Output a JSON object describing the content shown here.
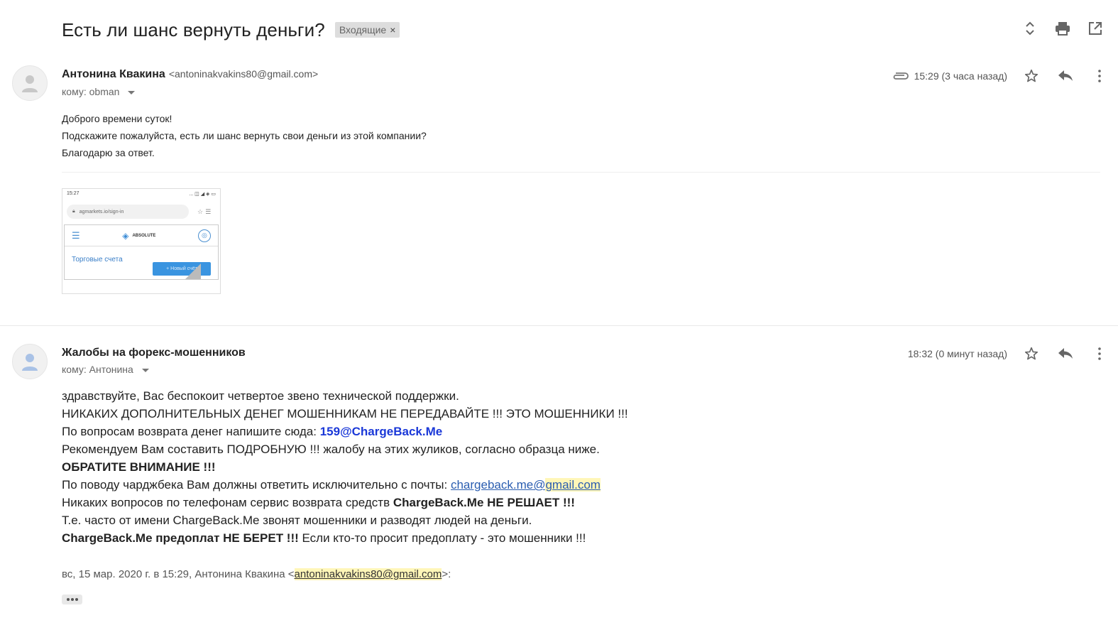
{
  "thread": {
    "subject": "Есть ли шанс вернуть деньги?",
    "label": "Входящие",
    "label_remove": "×"
  },
  "toolbar_icons": [
    "expand-all-icon",
    "print-icon",
    "open-new-window-icon"
  ],
  "message1": {
    "sender_name": "Антонина Квакина",
    "sender_email": "<antoninakvakins80@gmail.com>",
    "to_label": "кому: obman",
    "time": "15:29 (3 часа назад)",
    "has_attachment": true,
    "body": [
      "Доброго времени суток!",
      "Подскажите пожалуйста, есть ли шанс вернуть свои деньги из этой компании?",
      "Благодарю за ответ."
    ],
    "attachment": {
      "status_time": "15:27",
      "status_icons": "... ◫ ◢ ◈ ▭",
      "url": "agmarkets.io/sign-in",
      "logo_text": "ABSOLUTE",
      "title": "Торговые счета",
      "button": "+ Новый счёт"
    }
  },
  "message2": {
    "sender_name": "Жалобы на форекс-мошенников",
    "to_label": "кому: Антонина",
    "time": "18:32 (0 минут назад)",
    "lines": {
      "l1": "здравствуйте, Вас беспокоит четвертое звено технической поддержки.",
      "l2": "НИКАКИХ ДОПОЛНИТЕЛЬНЫХ ДЕНЕГ МОШЕННИКАМ НЕ ПЕРЕДАВАЙТЕ !!! ЭТО МОШЕННИКИ !!!",
      "l3_text": "По вопросам возврата денег напишите сюда: ",
      "l3_email": "159@ChargeBack.Me",
      "l4": "Рекомендуем Вам составить ПОДРОБНУЮ !!! жалобу на этих жуликов, согласно образца ниже.",
      "l5": "ОБРАТИТЕ ВНИМАНИЕ !!!",
      "l6_text": "По поводу чарджбека Вам должны ответить исключительно с почты: ",
      "l6_link_a": "chargeback.me@",
      "l6_link_b": "gmail.com",
      "l7_text": "Никаких вопросов по телефонам сервис возврата средств ",
      "l7_bold": "ChargeBack.Me НЕ РЕШАЕТ !!!",
      "l8": "Т.е. часто от имени ChargeBack.Me звонят мошенники и разводят людей на деньги.",
      "l9_bold": "ChargeBack.Me предоплат НЕ БЕРЕТ !!!",
      "l9_text": " Если кто-то просит предоплату - это мошенники !!!"
    },
    "quote_prefix": "вс, 15 мар. 2020 г. в 15:29, Антонина Квакина <",
    "quote_email": "antoninakvakins80@gmail.com",
    "quote_suffix": ">:"
  },
  "colors": {
    "accent_link": "#2a5db0",
    "blue_bold": "#1a38d8",
    "highlight": "#fff6b8"
  }
}
